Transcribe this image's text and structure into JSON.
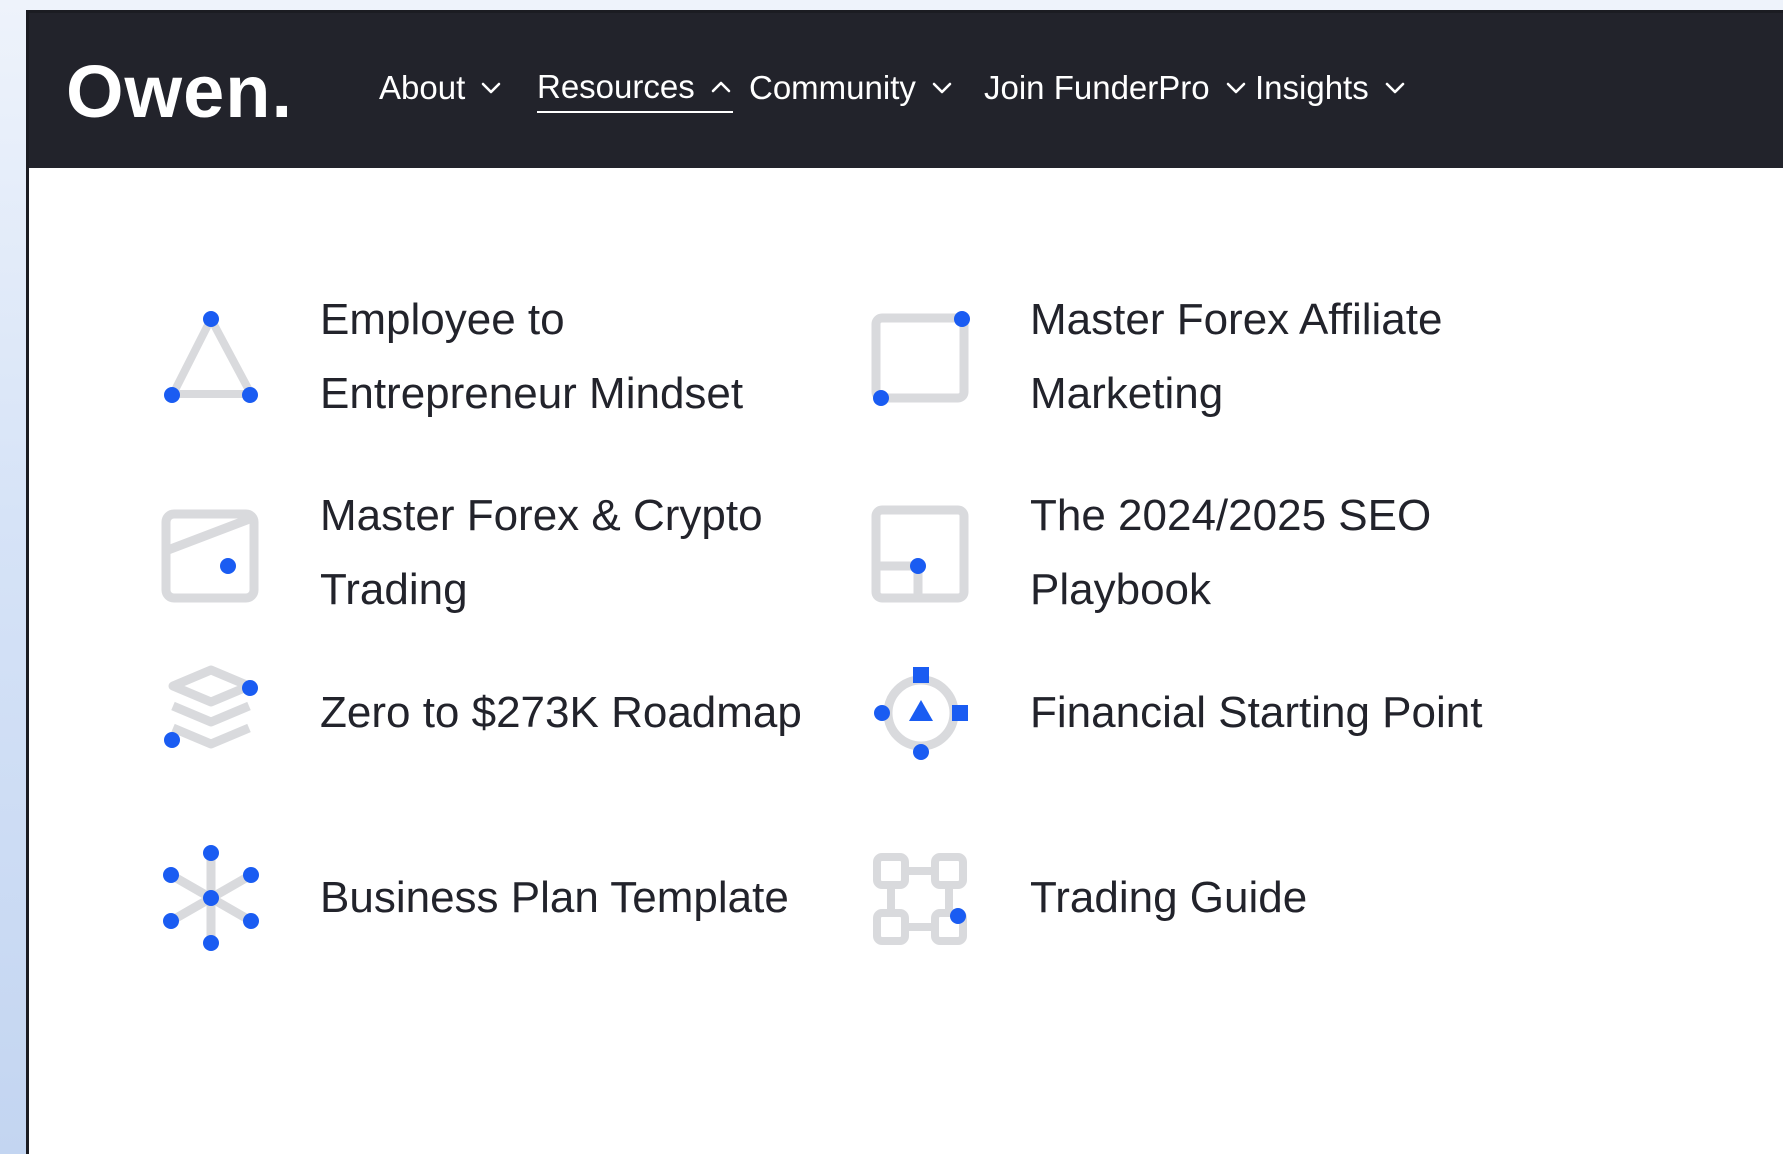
{
  "brand": {
    "logo_text": "Owen."
  },
  "nav": {
    "items": [
      {
        "label": "About",
        "state": "collapsed",
        "chevron": "chevron-down"
      },
      {
        "label": "Resources",
        "state": "expanded",
        "chevron": "chevron-up"
      },
      {
        "label": "Community",
        "state": "collapsed",
        "chevron": "chevron-down"
      },
      {
        "label": "Join FunderPro",
        "state": "collapsed",
        "chevron": "chevron-down"
      },
      {
        "label": "Insights",
        "state": "collapsed",
        "chevron": "chevron-down"
      }
    ]
  },
  "resources_menu": {
    "items": [
      {
        "line1": "Employee to",
        "line2": "Entrepreneur Mindset",
        "icon": "triangle-nodes-icon"
      },
      {
        "line1": "Master Forex Affiliate",
        "line2": "Marketing",
        "icon": "square-nodes-icon"
      },
      {
        "line1": "Master Forex & Crypto",
        "line2": "Trading",
        "icon": "tilted-square-icon"
      },
      {
        "line1": "The 2024/2025 SEO",
        "line2": "Playbook",
        "icon": "split-square-icon"
      },
      {
        "line1": "Zero to $273K Roadmap",
        "icon": "stacked-layers-icon"
      },
      {
        "line1": "Financial Starting Point",
        "icon": "compass-target-icon"
      },
      {
        "line1": "Business Plan Template",
        "icon": "asterisk-nodes-icon"
      },
      {
        "line1": "Trading Guide",
        "icon": "flowchart-blocks-icon"
      }
    ]
  },
  "colors": {
    "nav_background": "#22232b",
    "accent_blue": "#1a5cf2",
    "icon_gray": "#d9dadd",
    "text_dark": "#22232b"
  }
}
